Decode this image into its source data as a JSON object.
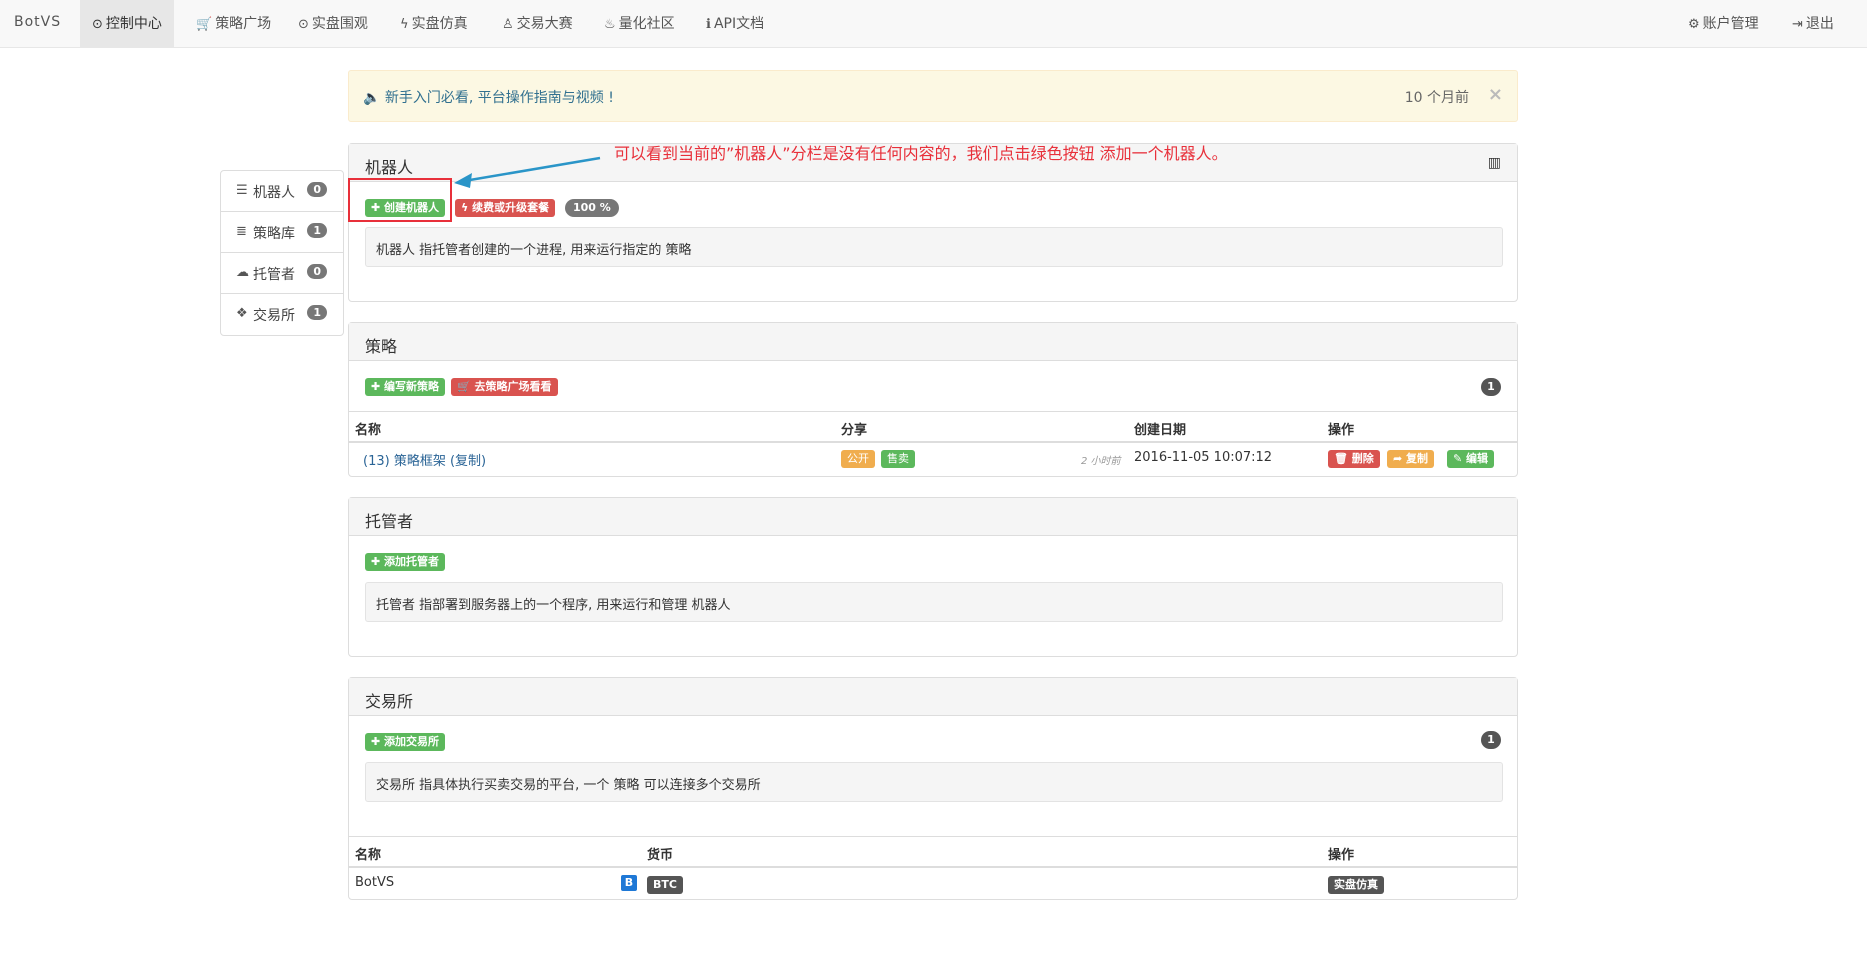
{
  "nav": {
    "brand": "BotVS",
    "items": [
      {
        "icon": "dashboard-icon",
        "glyph": "⊙",
        "label": "控制中心",
        "active": true
      },
      {
        "icon": "cart-icon",
        "glyph": "🛒",
        "label": "策略广场"
      },
      {
        "icon": "eye-icon",
        "glyph": "⊙",
        "label": "实盘围观"
      },
      {
        "icon": "flash-icon",
        "glyph": "ϟ",
        "label": "实盘仿真"
      },
      {
        "icon": "trophy-icon",
        "glyph": "♙",
        "label": "交易大赛"
      },
      {
        "icon": "fire-icon",
        "glyph": "♨",
        "label": "量化社区"
      },
      {
        "icon": "info-icon",
        "glyph": "ℹ",
        "label": "API文档"
      }
    ],
    "right": [
      {
        "icon": "gear-icon",
        "glyph": "⚙",
        "label": "账户管理"
      },
      {
        "icon": "logout-icon",
        "glyph": "⇥",
        "label": "退出"
      }
    ]
  },
  "alert": {
    "icon": "megaphone-icon",
    "message": "🔈 新手入门必看, 平台操作指南与视频 !",
    "time": "10 个月前",
    "close": "×"
  },
  "side": {
    "items": [
      {
        "icon": "robot-icon",
        "glyph": "☰",
        "label": "机器人",
        "count": "0"
      },
      {
        "icon": "database-icon",
        "glyph": "≣",
        "label": "策略库",
        "count": "1"
      },
      {
        "icon": "cloud-icon",
        "glyph": "☁",
        "label": "托管者",
        "count": "0"
      },
      {
        "icon": "exchange-icon",
        "glyph": "❖",
        "label": "交易所",
        "count": "1"
      }
    ]
  },
  "annotation": "可以看到当前的”机器人”分栏是没有任何内容的，我们点击绿色按钮 添加一个机器人。",
  "robots": {
    "title": "机器人",
    "create_btn": "✚ 创建机器人",
    "renew_btn": "ϟ 续费或升级套餐",
    "percent": "100 %",
    "desc": "机器人 指托管者创建的一个进程, 用来运行指定的 策略"
  },
  "strategies": {
    "title": "策略",
    "new_btn": "✚ 编写新策略",
    "square_btn": "🛒 去策略广场看看",
    "count": "1",
    "headers": [
      "名称",
      "分享",
      "创建日期",
      "操作"
    ],
    "row": {
      "name": "(13) 策略框架 (复制)",
      "tag_public": "公开",
      "tag_sale": "售卖",
      "ago": "2 小时前",
      "date": "2016-11-05 10:07:12",
      "delete": "🗑 删除",
      "copy": "➦ 复制",
      "edit": "✎ 编辑"
    }
  },
  "hosts": {
    "title": "托管者",
    "add_btn": "✚ 添加托管者",
    "desc": "托管者 指部署到服务器上的一个程序, 用来运行和管理 机器人"
  },
  "exchanges": {
    "title": "交易所",
    "add_btn": "✚ 添加交易所",
    "count": "1",
    "desc": "交易所 指具体执行买卖交易的平台, 一个 策略 可以连接多个交易所",
    "headers": [
      "名称",
      "货币",
      "操作"
    ],
    "row": {
      "name": "BotVS",
      "badge": "B",
      "currency": "BTC",
      "action": "实盘仿真"
    }
  }
}
